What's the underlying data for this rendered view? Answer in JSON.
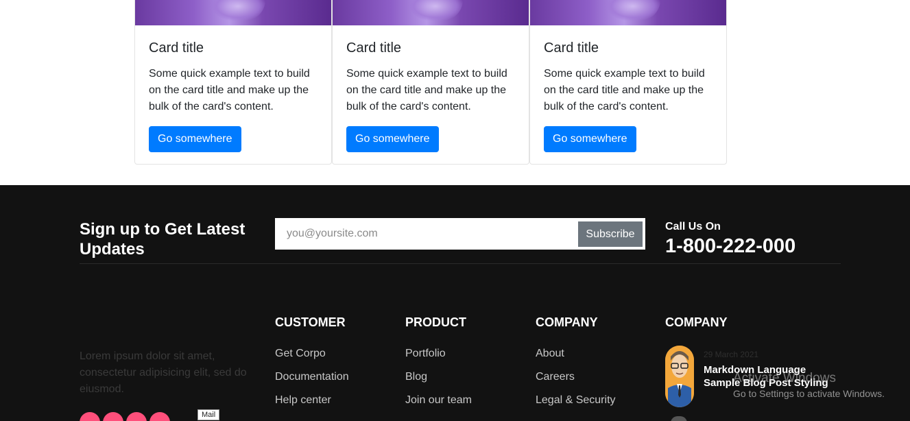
{
  "cards": [
    {
      "title": "Card title",
      "text": "Some quick example text to build on the card title and make up the bulk of the card's content.",
      "button": "Go somewhere"
    },
    {
      "title": "Card title",
      "text": "Some quick example text to build on the card title and make up the bulk of the card's content.",
      "button": "Go somewhere"
    },
    {
      "title": "Card title",
      "text": "Some quick example text to build on the card title and make up the bulk of the card's content.",
      "button": "Go somewhere"
    }
  ],
  "footer": {
    "signup_title": "Sign up to Get Latest Updates",
    "email_placeholder": "you@yoursite.com",
    "subscribe_label": "Subscribe",
    "call_label": "Call Us On",
    "phone": "1-800-222-000",
    "about_text": "Lorem ipsum dolor sit amet, consectetur adipisicing elit, sed do eiusmod.",
    "mail_tooltip": "Mail",
    "columns": [
      {
        "heading": "CUSTOMER",
        "links": [
          "Get Corpo",
          "Documentation",
          "Help center"
        ]
      },
      {
        "heading": "PRODUCT",
        "links": [
          "Portfolio",
          "Blog",
          "Join our team"
        ]
      },
      {
        "heading": "COMPANY",
        "links": [
          "About",
          "Careers",
          "Legal & Security"
        ]
      }
    ],
    "recent": {
      "heading": "COMPANY",
      "post_date": "29 March 2021",
      "post_title": "Markdown Language Sample Blog Post Styling"
    }
  },
  "watermark": {
    "title": "Activate Windows",
    "subtitle": "Go to Settings to activate Windows."
  },
  "colors": {
    "primary_button": "#007bff",
    "footer_bg": "#121212",
    "subscribe_bg": "#6c757d",
    "social": "#ff4f7b"
  }
}
